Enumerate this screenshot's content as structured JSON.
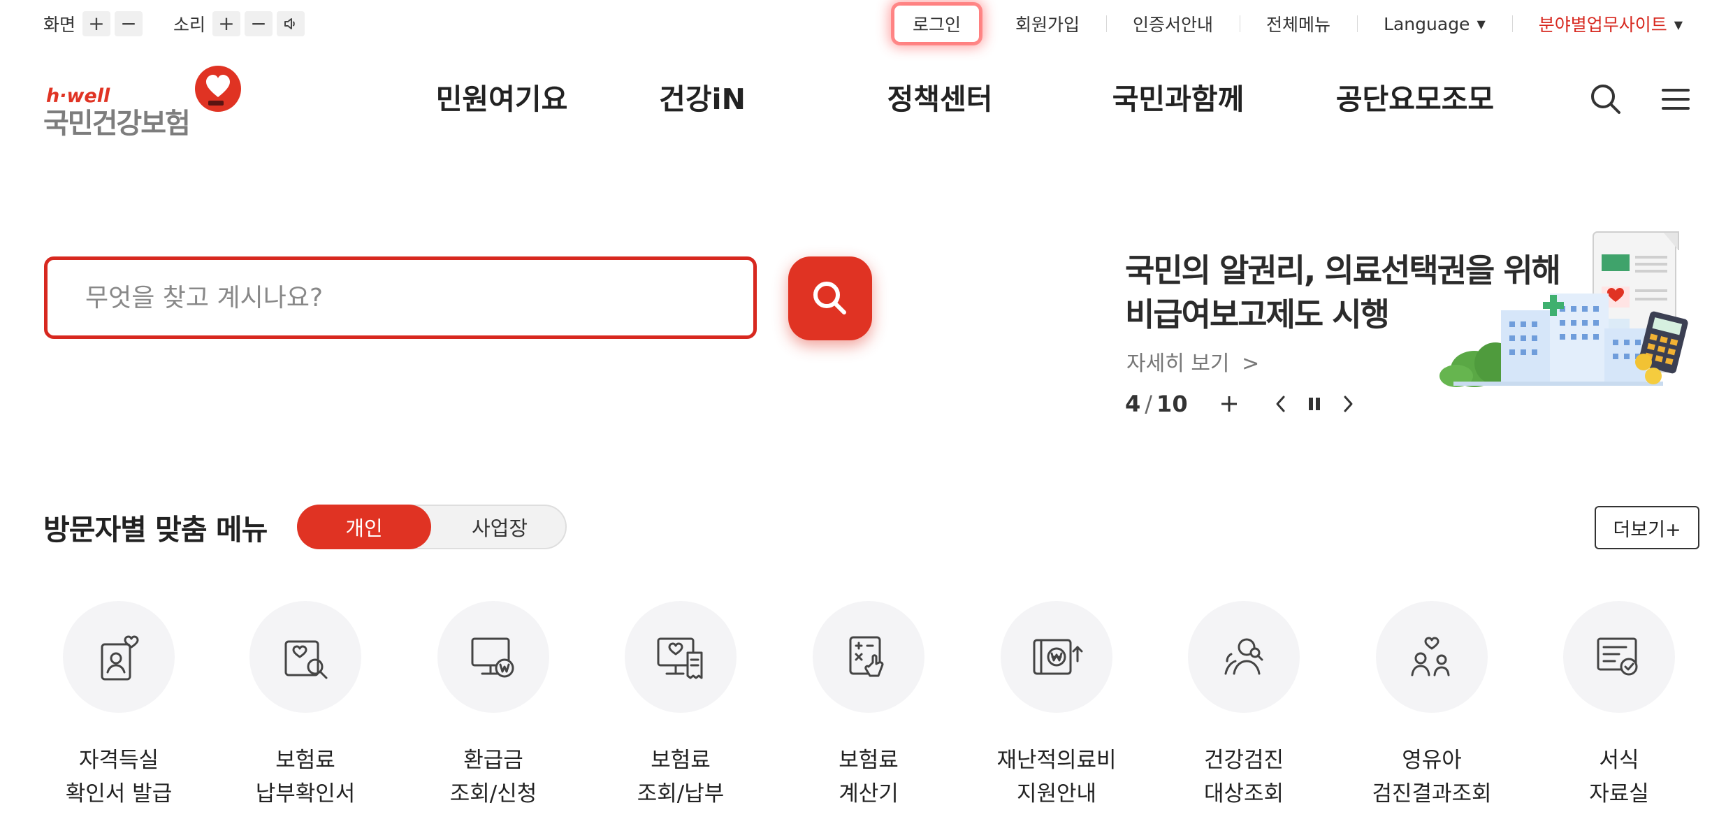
{
  "utility": {
    "screen_label": "화면",
    "sound_label": "소리",
    "plus": "+",
    "minus": "−",
    "links": {
      "login": "로그인",
      "signup": "회원가입",
      "certificate": "인증서안내",
      "all_menu": "전체메뉴",
      "language": "Language",
      "field_sites": "분야별업무사이트"
    }
  },
  "header": {
    "logo": {
      "top_text": "h·well",
      "main_text": "국민건강보험"
    },
    "nav": [
      {
        "label": "민원여기요"
      },
      {
        "label": "건강iN"
      },
      {
        "label": "정책센터"
      },
      {
        "label": "국민과함께"
      },
      {
        "label": "공단요모조모"
      }
    ]
  },
  "search": {
    "placeholder": "무엇을 찾고 계시나요?"
  },
  "banner": {
    "title_line1": "국민의 알권리, 의료선택권을 위해",
    "title_line2": "비급여보고제도 시행",
    "more_label": "자세히 보기",
    "current": "4",
    "separator": "/",
    "total": "10"
  },
  "visitor_menu": {
    "title": "방문자별 맞춤 메뉴",
    "tabs": [
      "개인",
      "사업장"
    ],
    "active_tab": "개인",
    "more_label": "더보기+",
    "items": [
      {
        "line1": "자격득실",
        "line2": "확인서 발급",
        "icon": "id-card-heart-icon"
      },
      {
        "line1": "보험료",
        "line2": "납부확인서",
        "icon": "document-search-icon"
      },
      {
        "line1": "환급금",
        "line2": "조회/신청",
        "icon": "monitor-won-icon"
      },
      {
        "line1": "보험료",
        "line2": "조회/납부",
        "icon": "monitor-receipt-icon"
      },
      {
        "line1": "보험료",
        "line2": "계산기",
        "icon": "calculator-hand-icon"
      },
      {
        "line1": "재난적의료비",
        "line2": "지원안내",
        "icon": "wallet-won-icon"
      },
      {
        "line1": "건강검진",
        "line2": "대상조회",
        "icon": "people-check-icon"
      },
      {
        "line1": "영유아",
        "line2": "검진결과조회",
        "icon": "parent-child-icon"
      },
      {
        "line1": "서식",
        "line2": "자료실",
        "icon": "form-check-icon"
      }
    ]
  },
  "colors": {
    "brand_red": "#e03323",
    "text": "#222222"
  }
}
